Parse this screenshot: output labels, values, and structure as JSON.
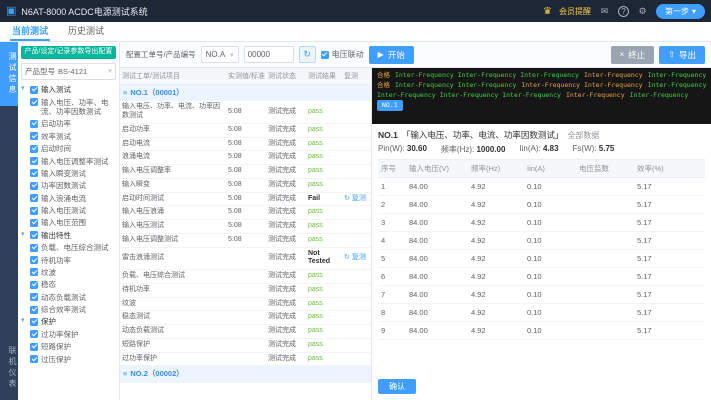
{
  "icons": {
    "logo": "▣",
    "crown": "♛",
    "message": "✉",
    "help": "?",
    "gear": "⚙",
    "caret": "▾",
    "play": "▶",
    "stop": "×",
    "export": "⇧",
    "retest": "↻",
    "menu": "≡"
  },
  "titlebar": {
    "app_title": "N6AT-8000 ACDC电源测试系统",
    "member_text": "会员提醒",
    "step_button": "第一步"
  },
  "tabs": [
    {
      "id": "current-test",
      "label": "当前测试",
      "active": true
    },
    {
      "id": "history-test",
      "label": "历史测试",
      "active": false
    }
  ],
  "rail": {
    "top": "测试信息",
    "bottom": "联机仪表"
  },
  "left_panel": {
    "export_button": "产品/设定/记录参数导出配置",
    "model": {
      "label": "产品型号",
      "value": "BS-4121"
    },
    "tree": [
      {
        "label": "输入测试",
        "children": [
          "输入电压、功率、电流、功率因数测试",
          "启动功率",
          "效率测试",
          "启动时间",
          "输入电压调整率测试",
          "输入瞬变测试",
          "功率因数测试",
          "输入浪涌电流",
          "输入电压测试",
          "输入电压范围"
        ]
      },
      {
        "label": "输出特性",
        "children": [
          "负载、电压综合测试",
          "待机功率",
          "纹波",
          "稳态",
          "动态负载测试",
          "综合效率测试"
        ]
      },
      {
        "label": "保护",
        "children": [
          "过功率保护",
          "短路保护",
          "过压保护"
        ]
      }
    ]
  },
  "toolbar": {
    "config_label": "配置工单号/产品编号",
    "workorder": "NO.A",
    "serial": "00000",
    "linkage_checkbox": "电压联动",
    "start": "开始",
    "stop": "终止",
    "export": "导出"
  },
  "test_table": {
    "headers": [
      "测试工单/测试项目",
      "实测值/标准",
      "测试状态",
      "测试结果",
      "复测"
    ],
    "retest_label": "复测",
    "groups": [
      {
        "label": "NO.1（00001）"
      },
      {
        "label": "NO.2（00002）"
      }
    ],
    "rows": [
      {
        "name": "输入电压、功率、电流、功率因数测试",
        "value": "5.08",
        "status": "测试完成",
        "result": "pass",
        "retest": false
      },
      {
        "name": "启动功率",
        "value": "5.08",
        "status": "测试完成",
        "result": "pass",
        "retest": false
      },
      {
        "name": "启动电流",
        "value": "5.08",
        "status": "测试完成",
        "result": "pass",
        "retest": false
      },
      {
        "name": "浪涌电流",
        "value": "5.08",
        "status": "测试完成",
        "result": "pass",
        "retest": false
      },
      {
        "name": "输入电压调整率",
        "value": "5.08",
        "status": "测试完成",
        "result": "pass",
        "retest": false
      },
      {
        "name": "输入瞬变",
        "value": "5.08",
        "status": "测试完成",
        "result": "pass",
        "retest": false
      },
      {
        "name": "启动时间测试",
        "value": "5.08",
        "status": "测试完成",
        "result": "Fail",
        "retest": true
      },
      {
        "name": "输入电压浪涌",
        "value": "5.08",
        "status": "测试完成",
        "result": "pass",
        "retest": false
      },
      {
        "name": "输入电压测试",
        "value": "5.08",
        "status": "测试完成",
        "result": "pass",
        "retest": false
      },
      {
        "name": "输入电压调整测试",
        "value": "5.08",
        "status": "测试完成",
        "result": "pass",
        "retest": false
      },
      {
        "name": "雷击浪涌测试",
        "value": "",
        "status": "测试完成",
        "result": "Not Tested",
        "retest": true
      },
      {
        "name": "负载、电压综合测试",
        "value": "",
        "status": "测试完成",
        "result": "pass",
        "retest": false
      },
      {
        "name": "待机功率",
        "value": "",
        "status": "测试完成",
        "result": "pass",
        "retest": false
      },
      {
        "name": "纹波",
        "value": "",
        "status": "测试完成",
        "result": "pass",
        "retest": false
      },
      {
        "name": "稳态测试",
        "value": "",
        "status": "测试完成",
        "result": "pass",
        "retest": false
      },
      {
        "name": "动态负载测试",
        "value": "",
        "status": "测试完成",
        "result": "pass",
        "retest": false
      },
      {
        "name": "短路保护",
        "value": "",
        "status": "测试完成",
        "result": "pass",
        "retest": false
      },
      {
        "name": "过功率保护",
        "value": "",
        "status": "测试完成",
        "result": "pass",
        "retest": false
      }
    ]
  },
  "log_panel": {
    "lines": [
      {
        "segments": [
          {
            "text": "合格",
            "color": "orange"
          },
          {
            "text": "Inter-Frequency  Inter-Frequency  Inter-Frequency",
            "color": "green"
          },
          {
            "text": "Inter-Frequency",
            "color": "orange"
          },
          {
            "text": "Inter-Frequency",
            "color": "green"
          }
        ]
      },
      {
        "segments": [
          {
            "text": "合格",
            "color": "orange"
          },
          {
            "text": "Inter-Frequency  Inter-Frequency",
            "color": "green"
          },
          {
            "text": "Inter-Frequency  Inter-Frequency",
            "color": "orange"
          },
          {
            "text": "Inter-Frequency",
            "color": "green"
          }
        ]
      },
      {
        "segments": [
          {
            "text": "Inter-Frequency  Inter-Frequency  Inter-Frequency",
            "color": "green"
          },
          {
            "text": "Inter-Frequency",
            "color": "orange"
          },
          {
            "text": "Inter-Frequency",
            "color": "green"
          }
        ]
      },
      {
        "segments": [
          {
            "text": "NO.1",
            "color": "tag"
          }
        ]
      }
    ]
  },
  "result_panel": {
    "no": "NO.1",
    "title": "「输入电压、功率、电流、功率因数测试」",
    "suffix": "全部数据",
    "summary": [
      {
        "label": "Pin(W):",
        "value": "30.60"
      },
      {
        "label": "频率(Hz):",
        "value": "1000.00"
      },
      {
        "label": "Iin(A):",
        "value": "4.83"
      },
      {
        "label": "Fs(W):",
        "value": "5.75"
      }
    ],
    "table": {
      "headers": [
        "序号",
        "输入电压(V)",
        "频率(Hz)",
        "Iin(A)",
        "电压监数",
        "效率(%)"
      ],
      "rows": [
        [
          "1",
          "84.00",
          "4.92",
          "0.10",
          "",
          "5.17"
        ],
        [
          "2",
          "84.00",
          "4.92",
          "0.10",
          "",
          "5.17"
        ],
        [
          "3",
          "84.00",
          "4.92",
          "0.10",
          "",
          "5.17"
        ],
        [
          "4",
          "84.00",
          "4.92",
          "0.10",
          "",
          "5.17"
        ],
        [
          "5",
          "84.00",
          "4.92",
          "0.10",
          "",
          "5.17"
        ],
        [
          "6",
          "84.00",
          "4.92",
          "0.10",
          "",
          "5.17"
        ],
        [
          "7",
          "84.00",
          "4.92",
          "0.10",
          "",
          "5.17"
        ],
        [
          "8",
          "84.00",
          "4.92",
          "0.10",
          "",
          "5.17"
        ],
        [
          "9",
          "84.00",
          "4.92",
          "0.10",
          "",
          "5.17"
        ]
      ]
    },
    "confirm_button": "确认"
  }
}
